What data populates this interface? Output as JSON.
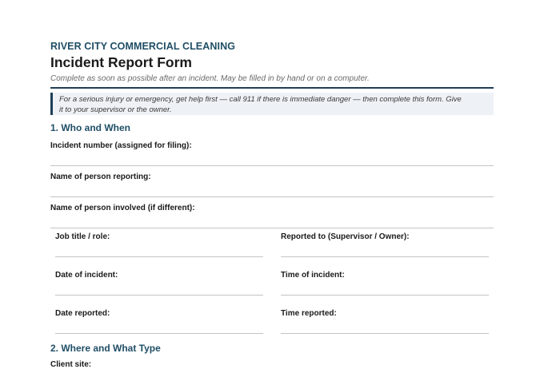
{
  "header": {
    "company": "RIVER CITY COMMERCIAL CLEANING",
    "title": "Incident Report Form",
    "subtitle": "Complete as soon as possible after an incident. May be filled in by hand or on a computer."
  },
  "notice": {
    "line1": "For a serious injury or emergency, get help first — call 911 if there is immediate danger — then complete this form. Give",
    "line2": "it to your supervisor or the owner."
  },
  "sections": [
    {
      "title": "1.  Who and When",
      "fields": {
        "incident_number": "Incident number (assigned for filing):",
        "person_reporting": "Name of person reporting:",
        "person_involved": "Name of person involved (if different):",
        "job_title": "Job title / role:",
        "reported_to": "Reported to (Supervisor / Owner):",
        "date_of_incident": "Date of incident:",
        "time_of_incident": "Time of incident:",
        "date_reported": "Date reported:",
        "time_reported": "Time reported:"
      }
    },
    {
      "title": "2.  Where and What Type",
      "fields": {
        "client_site": "Client site:"
      }
    }
  ]
}
